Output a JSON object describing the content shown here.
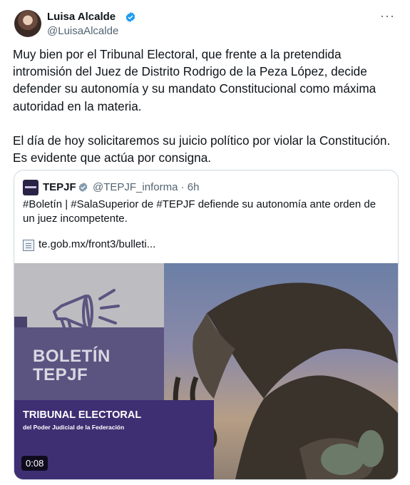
{
  "tweet": {
    "author_name": "Luisa Alcalde",
    "author_handle": "@LuisaAlcalde",
    "more_label": "···",
    "paragraphs": [
      "Muy bien por el Tribunal Electoral, que frente a la pretendida intromisión del Juez de Distrito Rodrigo de la Peza López, decide defender su autonomía y su mandato Constitucional como máxima autoridad en la materia.",
      "El día de hoy solicitaremos su juicio político por violar la Constitución. Es evidente que actúa por consigna."
    ]
  },
  "quote": {
    "author_name": "TEPJF",
    "author_handle": "@TEPJF_informa · 6h",
    "text": "#Boletín | #SalaSuperior de #TEPJF defiende su autonomía ante orden de un juez incompetente.",
    "link": "te.gob.mx/front3/bulleti...",
    "media": {
      "title_line1": "BOLETÍN",
      "title_line2": "TEPJF",
      "org_name": "TRIBUNAL ELECTORAL",
      "org_sub": "del Poder Judicial de la Federación",
      "duration": "0:08"
    }
  },
  "colors": {
    "verified": "#1d9bf0",
    "purple": "#3e2f73"
  }
}
